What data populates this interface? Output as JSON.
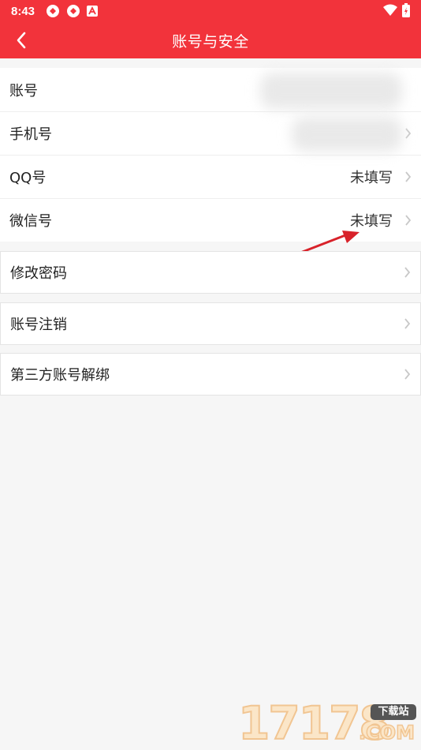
{
  "status": {
    "time": "8:43"
  },
  "header": {
    "title": "账号与安全"
  },
  "account_group": [
    {
      "label": "账号",
      "value": ""
    },
    {
      "label": "手机号",
      "value": ""
    },
    {
      "label": "QQ号",
      "value": "未填写"
    },
    {
      "label": "微信号",
      "value": "未填写"
    }
  ],
  "change_password": {
    "label": "修改密码"
  },
  "cancel_account": {
    "label": "账号注销"
  },
  "unbind_third_party": {
    "label": "第三方账号解绑"
  },
  "watermark": {
    "digits": "17178",
    "badge": "下载站",
    "suffix": ".COM"
  },
  "colors": {
    "brand": "#f2333b",
    "background": "#f6f6f6",
    "arrow": "#d8222a"
  }
}
